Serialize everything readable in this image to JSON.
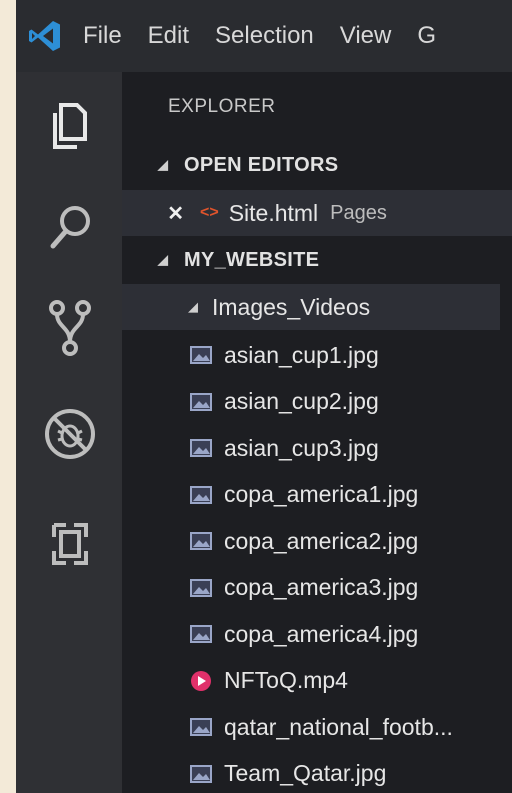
{
  "menu": [
    "File",
    "Edit",
    "Selection",
    "View",
    "G"
  ],
  "sidebar": {
    "title": "EXPLORER",
    "open_editors": {
      "label": "OPEN EDITORS",
      "items": [
        {
          "close_glyph": "✕",
          "type_glyph": "<>",
          "name": "Site.html",
          "folder": "Pages"
        }
      ]
    },
    "project": {
      "label": "MY_WEBSITE",
      "folder": "Images_Videos",
      "files": [
        {
          "name": "asian_cup1.jpg",
          "icon": "image-file-icon"
        },
        {
          "name": "asian_cup2.jpg",
          "icon": "image-file-icon"
        },
        {
          "name": "asian_cup3.jpg",
          "icon": "image-file-icon"
        },
        {
          "name": "copa_america1.jpg",
          "icon": "image-file-icon"
        },
        {
          "name": "copa_america2.jpg",
          "icon": "image-file-icon"
        },
        {
          "name": "copa_america3.jpg",
          "icon": "image-file-icon"
        },
        {
          "name": "copa_america4.jpg",
          "icon": "image-file-icon"
        },
        {
          "name": "NFToQ.mp4",
          "icon": "video-file-icon"
        },
        {
          "name": "qatar_national_footb...",
          "icon": "image-file-icon"
        },
        {
          "name": "Team_Qatar.jpg",
          "icon": "image-file-icon"
        }
      ]
    }
  },
  "colors": {
    "accent": "#2d8fd6",
    "video": "#e0306a",
    "html": "#e0542c",
    "image_icon": "#9aa6c8"
  }
}
